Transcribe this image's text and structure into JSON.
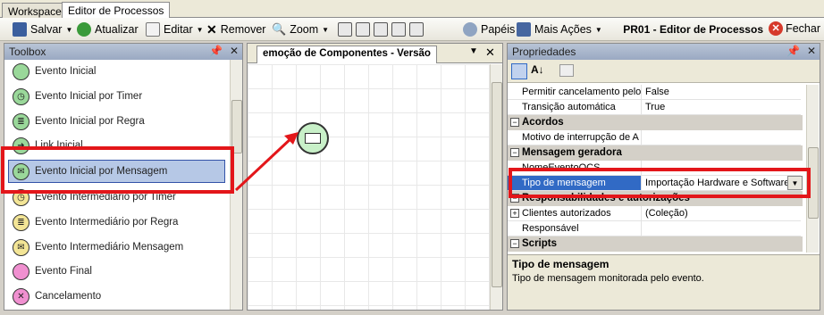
{
  "tabs": {
    "workspace": "Workspace",
    "editor": "Editor de Processos"
  },
  "toolbar": {
    "save": "Salvar",
    "refresh": "Atualizar",
    "edit": "Editar",
    "remove": "Remover",
    "zoom": "Zoom",
    "roles": "Papéis",
    "more": "Mais Ações",
    "title": "PR01 - Editor de Processos",
    "close": "Fechar"
  },
  "toolbox": {
    "title": "Toolbox",
    "items": [
      "Evento Inicial",
      "Evento Inicial por Timer",
      "Evento Inicial por Regra",
      "Link Inicial",
      "Evento Inicial por Mensagem",
      "Evento Intermediário por Timer",
      "Evento Intermediário por Regra",
      "Evento Intermediário Mensagem",
      "Evento Final",
      "Cancelamento"
    ]
  },
  "canvas": {
    "title": "emoção de Componentes - Versão"
  },
  "props": {
    "title": "Propriedades",
    "row1_k": "Permitir cancelamento pelo",
    "row1_v": "False",
    "row2_k": "Transição automática",
    "row2_v": "True",
    "cat1": "Acordos",
    "row3_k": "Motivo de interrupção de A",
    "row3_v": "",
    "cat2": "Mensagem geradora",
    "row4_k": "NomeEventoOCS",
    "row4_v": "",
    "row5_k": "Tipo de mensagem",
    "row5_v": "Importação Hardware e Software",
    "cat3": "Responsabilidades e autorizações",
    "row6_k": "Clientes autorizados",
    "row6_v": "(Coleção)",
    "row7_k": "Responsável",
    "row7_v": "",
    "cat4": "Scripts",
    "help_title": "Tipo de mensagem",
    "help_text": "Tipo de mensagem monitorada pelo evento."
  }
}
